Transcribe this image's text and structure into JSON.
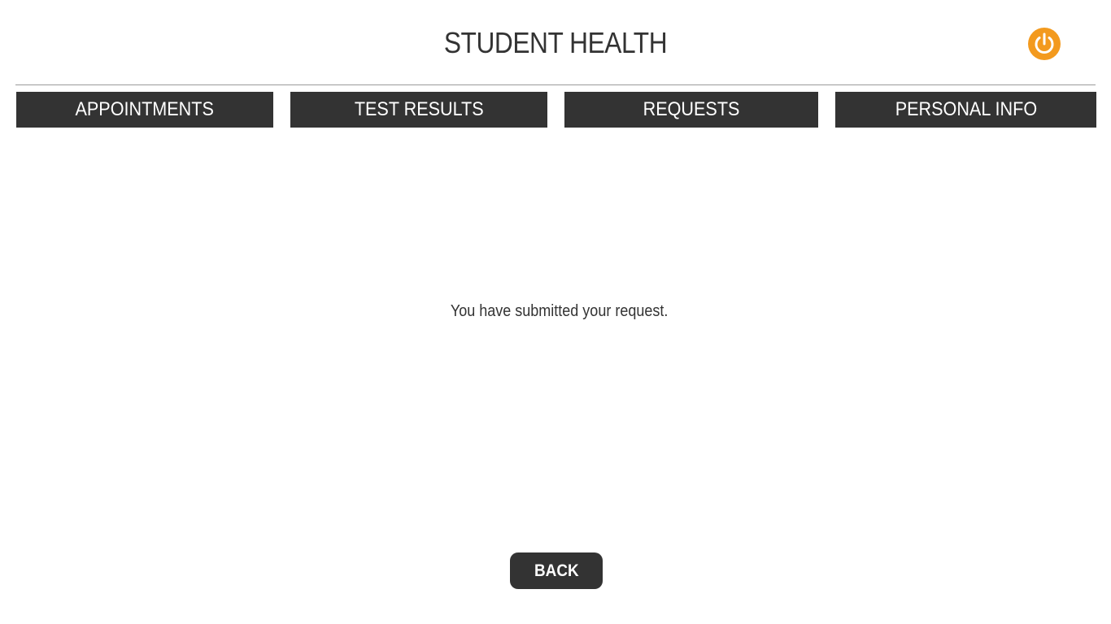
{
  "header": {
    "title": "STUDENT HEALTH",
    "power_icon": "power-icon",
    "accent_color": "#f39a1e"
  },
  "nav": {
    "tabs": [
      {
        "label": "APPOINTMENTS"
      },
      {
        "label": "TEST RESULTS"
      },
      {
        "label": "REQUESTS"
      },
      {
        "label": "PERSONAL INFO"
      }
    ],
    "tab_color": "#333333"
  },
  "main": {
    "message": "You have submitted your request."
  },
  "footer": {
    "back_label": "BACK"
  }
}
